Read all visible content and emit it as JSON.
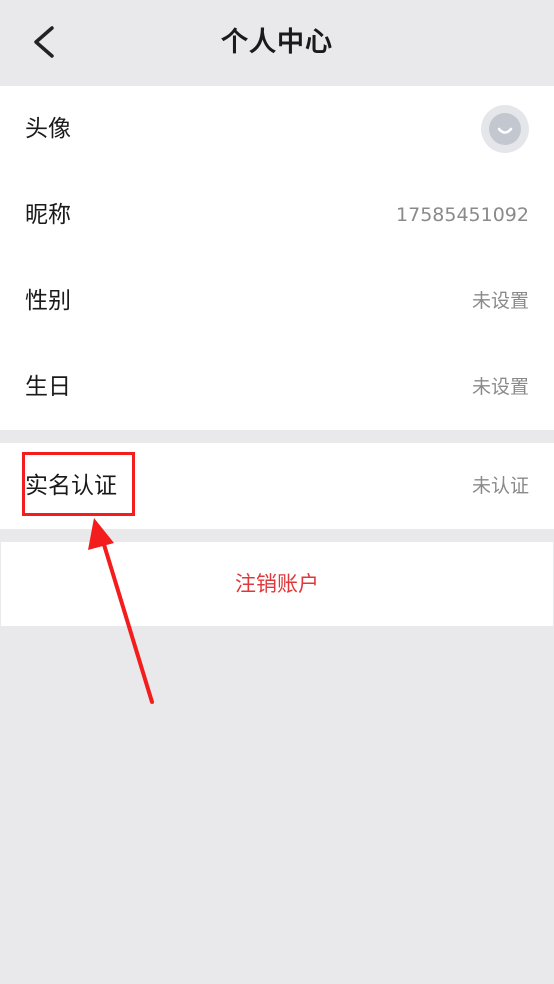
{
  "header": {
    "title": "个人中心",
    "back_icon": "chevron-left-icon"
  },
  "profile": {
    "avatar_label": "头像",
    "nickname_label": "昵称",
    "nickname_value": "17585451092",
    "gender_label": "性别",
    "gender_value": "未设置",
    "birthday_label": "生日",
    "birthday_value": "未设置"
  },
  "verification": {
    "label": "实名认证",
    "value": "未认证"
  },
  "logout": {
    "label": "注销账户"
  },
  "colors": {
    "background": "#e9e9eb",
    "card": "#ffffff",
    "danger": "#e0383a",
    "annotation": "#f41d1d"
  }
}
